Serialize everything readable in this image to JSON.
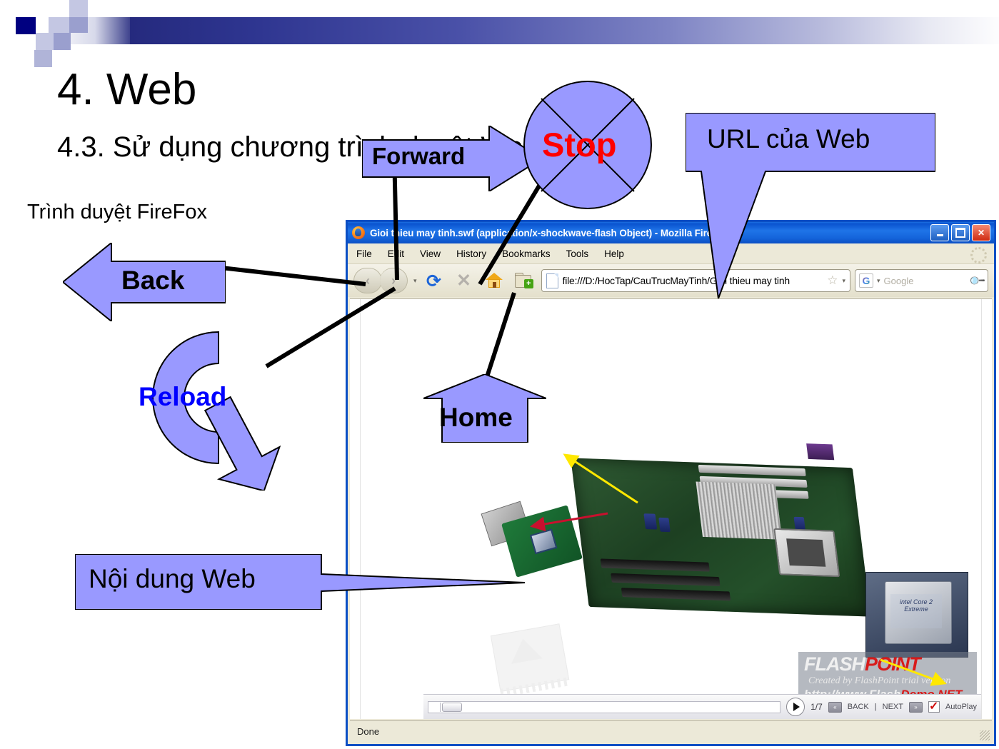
{
  "slide": {
    "title_main": "4. Web",
    "title_sub": "4.3. Sử dụng chương trình duyệt Web",
    "subtitle": "Trình duyệt FireFox"
  },
  "callouts": {
    "forward": {
      "label": "Forward",
      "color": "#9999FF",
      "text_color": "#000000"
    },
    "stop": {
      "label": "Stop",
      "color": "#9999FF",
      "text_color": "#FF0000"
    },
    "url": {
      "label": "URL của Web",
      "color": "#9999FF",
      "text_color": "#000000"
    },
    "back": {
      "label": "Back",
      "color": "#9999FF",
      "text_color": "#000000"
    },
    "reload": {
      "label": "Reload",
      "color": "#9999FF",
      "text_color": "#0000FF"
    },
    "home": {
      "label": "Home",
      "color": "#9999FF",
      "text_color": "#000000"
    },
    "content": {
      "label": "Nội dung Web",
      "color": "#9999FF",
      "text_color": "#000000"
    }
  },
  "browser": {
    "title": "Gioi thieu may tinh.swf (application/x-shockwave-flash Object) - Mozilla Firefox",
    "window_buttons": {
      "minimize": "_",
      "maximize": "□",
      "close": "✕"
    },
    "menu": [
      "File",
      "Edit",
      "View",
      "History",
      "Bookmarks",
      "Tools",
      "Help"
    ],
    "toolbar": {
      "back_icon": "‹",
      "forward_icon": "›",
      "dropdown_icon": "▾",
      "reload_icon": "⟳",
      "stop_icon": "✕",
      "home_icon": "home-icon",
      "newtab_icon": "folder-plus-icon"
    },
    "url": "file:///D:/HocTap/CauTrucMayTinh/Gioi thieu may tinh",
    "url_star": "☆",
    "url_dropdown": "▾",
    "search": {
      "engine": "G",
      "engine_dropdown": "▾",
      "placeholder": "Google",
      "icon": "search-icon"
    },
    "status": "Done"
  },
  "flash_player": {
    "play_icon": "▶",
    "counter": "1/7",
    "back_label": "BACK",
    "separator": "|",
    "next_label": "NEXT",
    "prev_icon": "«",
    "next_icon": "»",
    "autoplay_label": "AutoPlay",
    "autoplay_checked": true
  },
  "watermark": {
    "brand_a": "FLASH",
    "brand_b": "POINT",
    "tagline": "Created by FlashPoint trial version",
    "url_a": "http://www.Flash",
    "url_b": "Demo.NET"
  },
  "content_image": {
    "intel_label": "intel Core 2 Extreme",
    "arrow_yellow": "#FFE800",
    "arrow_red": "#C8102E"
  },
  "theme": {
    "accent_purple": "#9999FF",
    "header_navy": "#000080",
    "titlebar_blue": "#0B4FC4",
    "chrome_beige": "#ECE9D8"
  }
}
